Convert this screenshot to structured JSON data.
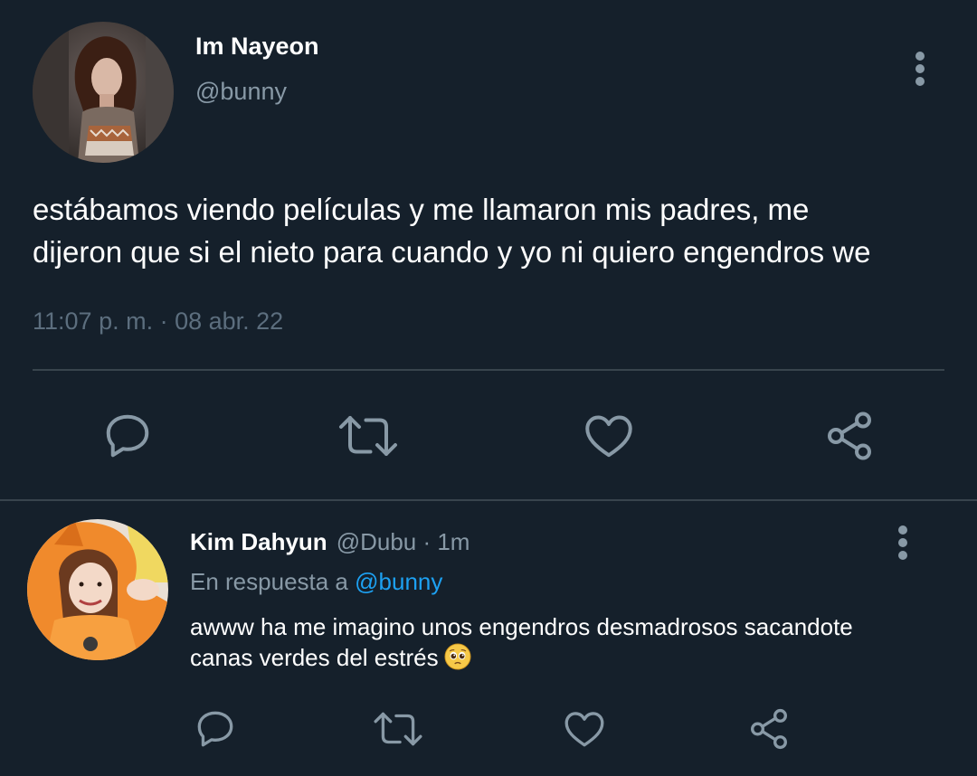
{
  "tweet": {
    "author_name": "Im Nayeon",
    "author_handle": "@bunny",
    "text_line_1": "estábamos viendo películas y me llamaron mis padres, me",
    "text_line_2": "dijeron que si el nieto para cuando y yo ni quiero engendros we",
    "timestamp": "11:07 p. m. · 08 abr. 22",
    "actions": [
      "reply-icon",
      "retweet-icon",
      "like-icon",
      "share-icon"
    ]
  },
  "reply": {
    "author_name": "Kim Dahyun",
    "author_handle": "@Dubu · 1m",
    "in_reply_prefix": "En respuesta a ",
    "in_reply_mention": "@bunny",
    "text_line_1": "awww ha me imagino unos engendros desmadrosos sacandote",
    "text_line_2": "canas verdes del estrés",
    "emoji": "pleading-face",
    "actions": [
      "reply-icon",
      "retweet-icon",
      "like-icon",
      "share-icon"
    ]
  },
  "colors": {
    "background": "#15202b",
    "secondary_text": "#8899a6",
    "timestamp_text": "#5c6e7e",
    "divider": "#38444d",
    "mention": "#1da1f2",
    "icon": "#8899a6"
  }
}
